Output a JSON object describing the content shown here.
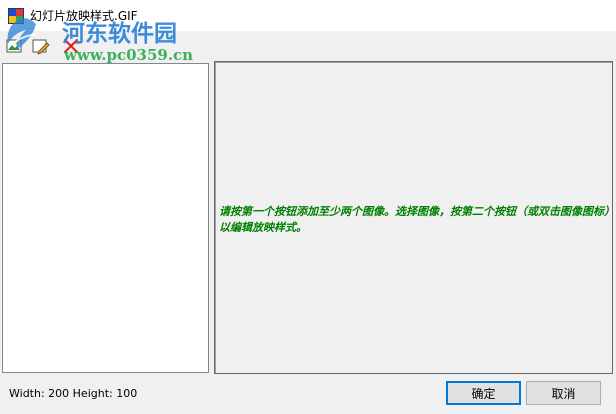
{
  "window": {
    "title": "幻灯片放映样式.GIF",
    "icon": "app-icon"
  },
  "toolbar": {
    "buttons": [
      {
        "name": "add-image",
        "icon": "add-image-icon"
      },
      {
        "name": "edit-image",
        "icon": "edit-image-icon"
      },
      {
        "name": "delete",
        "icon": "delete-x-icon",
        "color": "#e02020"
      }
    ]
  },
  "watermark": {
    "site_name": "河东软件园",
    "url": "www.pc0359.cn",
    "name_color": "#2a7fd6",
    "url_color": "#2aa84a"
  },
  "preview": {
    "instructions": "请按第一个按钮添加至少两个图像。选择图像，按第二个按钮（或双击图像图标）以编辑放映样式。",
    "text_color": "#008000"
  },
  "footer": {
    "size_label": "Width: 200  Height: 100",
    "ok_label": "确定",
    "cancel_label": "取消"
  }
}
